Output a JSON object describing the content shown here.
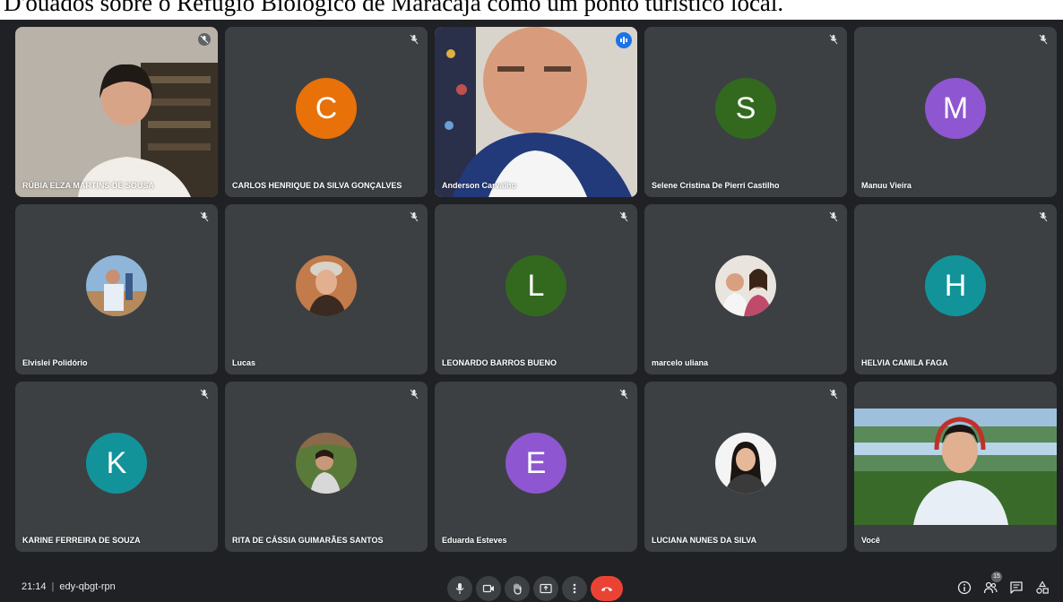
{
  "caption": {
    "text": "D'ouados sobre o Refúgio Biológico de Maracajá como um ponto turístico local."
  },
  "colors": {
    "background": "#202124",
    "tile": "#3c4043",
    "active_border": "#8ab4f8",
    "end_call": "#ea4335"
  },
  "participants": [
    {
      "name": "RÚBIA ELZA MARTINS DE SOUSA",
      "type": "video",
      "muted": true
    },
    {
      "name": "CARLOS HENRIQUE DA SILVA GONÇALVES",
      "type": "initial",
      "initial": "C",
      "color": "#e8710a",
      "muted": true
    },
    {
      "name": "Anderson Carvalho",
      "type": "video",
      "speaking": true
    },
    {
      "name": "Selene Cristina De Pierri Castilho",
      "type": "initial",
      "initial": "S",
      "color": "#33691e",
      "muted": true
    },
    {
      "name": "Manuu Vieira",
      "type": "initial",
      "initial": "M",
      "color": "#8e56d0",
      "muted": true
    },
    {
      "name": "Elvislei Polidório",
      "type": "photo",
      "muted": true
    },
    {
      "name": "Lucas",
      "type": "photo",
      "muted": true
    },
    {
      "name": "LEONARDO BARROS BUENO",
      "type": "initial",
      "initial": "L",
      "color": "#33691e",
      "muted": true
    },
    {
      "name": "marcelo uliana",
      "type": "photo",
      "muted": true
    },
    {
      "name": "HELVIA CAMILA FAGA",
      "type": "initial",
      "initial": "H",
      "color": "#12939a",
      "muted": true
    },
    {
      "name": "KARINE FERREIRA DE SOUZA",
      "type": "initial",
      "initial": "K",
      "color": "#12939a",
      "muted": true
    },
    {
      "name": "RITA DE CÁSSIA GUIMARÃES SANTOS",
      "type": "photo",
      "muted": true
    },
    {
      "name": "Eduarda Esteves",
      "type": "initial",
      "initial": "E",
      "color": "#8e56d0",
      "muted": true
    },
    {
      "name": "LUCIANA NUNES DA SILVA",
      "type": "photo",
      "muted": true
    },
    {
      "name": "Você",
      "type": "video",
      "muted": false
    }
  ],
  "bottom_bar": {
    "time": "21:14",
    "separator": "|",
    "meeting_code": "edy-qbgt-rpn",
    "controls": [
      "mic-icon",
      "camera-icon",
      "raise-hand-icon",
      "present-icon",
      "more-options-icon",
      "end-call-icon"
    ],
    "right_controls": [
      "info-icon",
      "people-icon",
      "chat-icon",
      "activities-icon"
    ],
    "people_count": "15"
  }
}
